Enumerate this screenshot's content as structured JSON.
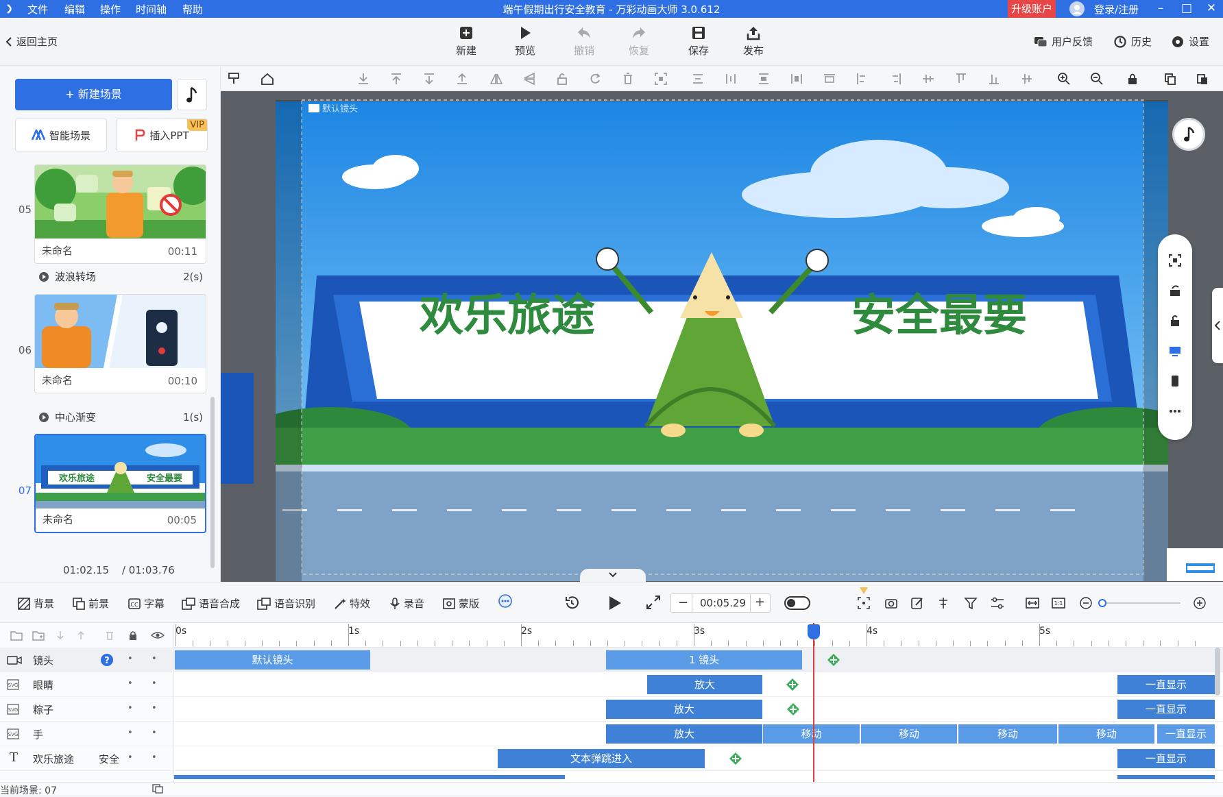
{
  "window": {
    "title": "端午假期出行安全教育 - 万彩动画大师 3.0.612",
    "menu": [
      "文件",
      "编辑",
      "操作",
      "时间轴",
      "帮助"
    ],
    "upgrade": "升级账户",
    "login": "登录/注册"
  },
  "toolbar": {
    "back": "返回主页",
    "buttons": [
      {
        "label": "新建",
        "icon": "new-icon",
        "enabled": true
      },
      {
        "label": "预览",
        "icon": "play-icon",
        "enabled": true
      },
      {
        "label": "撤销",
        "icon": "undo-icon",
        "enabled": false
      },
      {
        "label": "恢复",
        "icon": "redo-icon",
        "enabled": false
      },
      {
        "label": "保存",
        "icon": "save-icon",
        "enabled": true
      },
      {
        "label": "发布",
        "icon": "publish-icon",
        "enabled": true
      }
    ],
    "feedback": "用户反馈",
    "history": "历史",
    "settings": "设置"
  },
  "left": {
    "new_scene": "+ 新建场景",
    "smart_scene": "智能场景",
    "insert_ppt": "插入PPT",
    "vip": "VIP",
    "scenes": [
      {
        "num": "05",
        "name": "未命名",
        "duration": "00:11"
      },
      {
        "num": "06",
        "name": "未命名",
        "duration": "00:10"
      },
      {
        "num": "07",
        "name": "未命名",
        "duration": "00:05"
      }
    ],
    "transitions": [
      {
        "name": "波浪转场",
        "duration": "2(s)"
      },
      {
        "name": "中心渐变",
        "duration": "1(s)"
      }
    ],
    "current_time": "01:02.15",
    "total_time": "/ 01:03.76"
  },
  "stage": {
    "camera_label": "默认镜头",
    "banner_left": "欢乐旅途",
    "banner_right": "安全最要",
    "thumb_left": "欢乐旅途",
    "thumb_right": "安全最要"
  },
  "bottombar": {
    "tools": [
      "背景",
      "前景",
      "字幕",
      "语音合成",
      "语音识别",
      "特效",
      "录音",
      "蒙版"
    ],
    "time": "00:05.29"
  },
  "timeline": {
    "ticks": [
      "0s",
      "1s",
      "2s",
      "3s",
      "4s",
      "5s"
    ],
    "playhead_seconds": 3.69,
    "tracks": [
      {
        "name": "镜头",
        "clips": [
          {
            "label": "默认镜头"
          },
          {
            "label": "1 镜头"
          }
        ]
      },
      {
        "name": "眼睛",
        "clips": [
          {
            "label": "放大"
          },
          {
            "label": "一直显示"
          }
        ]
      },
      {
        "name": "粽子",
        "clips": [
          {
            "label": "放大"
          },
          {
            "label": "一直显示"
          }
        ]
      },
      {
        "name": "手",
        "clips": [
          {
            "label": "放大"
          },
          {
            "label": "移动"
          },
          {
            "label": "移动"
          },
          {
            "label": "移动"
          },
          {
            "label": "移动"
          },
          {
            "label": "一直显示"
          }
        ]
      },
      {
        "name": "欢乐旅途",
        "extra": "安全",
        "clips": [
          {
            "label": "文本弹跳进入"
          },
          {
            "label": "一直显示"
          }
        ]
      }
    ],
    "current_scene": "当前场景: 07"
  },
  "colors": {
    "accent": "#2f6fe4",
    "clip": "#5a9be7",
    "playhead": "#e53935",
    "keyframe": "#3cae5c"
  }
}
